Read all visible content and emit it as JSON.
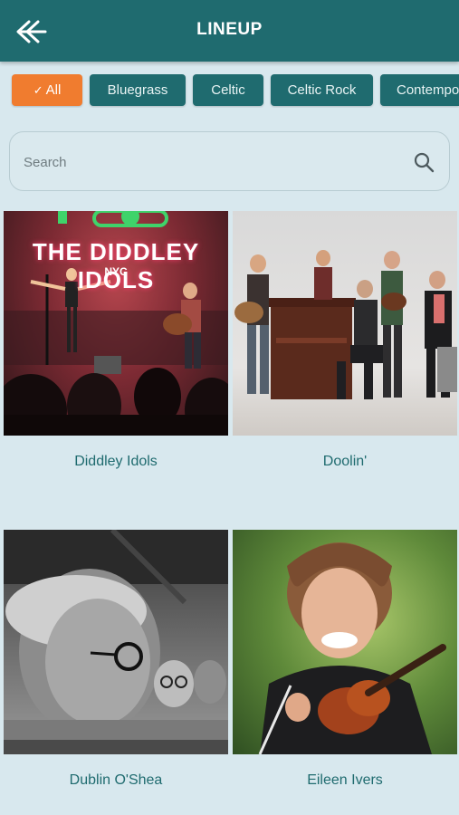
{
  "header": {
    "title": "LINEUP",
    "back_icon": "double-chevron-left-icon"
  },
  "filters": [
    {
      "label": "All",
      "selected": true
    },
    {
      "label": "Bluegrass",
      "selected": false
    },
    {
      "label": "Celtic",
      "selected": false
    },
    {
      "label": "Celtic Rock",
      "selected": false
    },
    {
      "label": "Contempo",
      "selected": false
    }
  ],
  "search": {
    "placeholder": "Search",
    "value": ""
  },
  "artists": [
    {
      "name": "Diddley Idols",
      "photo_text": "THE DIDDLEY IDOLS",
      "photo_sub": "NYC"
    },
    {
      "name": "Doolin'"
    },
    {
      "name": "Dublin O'Shea"
    },
    {
      "name": "Eileen Ivers"
    }
  ],
  "colors": {
    "primary": "#1f6b6f",
    "accent": "#f07c2f",
    "background": "#d8e8ee"
  }
}
